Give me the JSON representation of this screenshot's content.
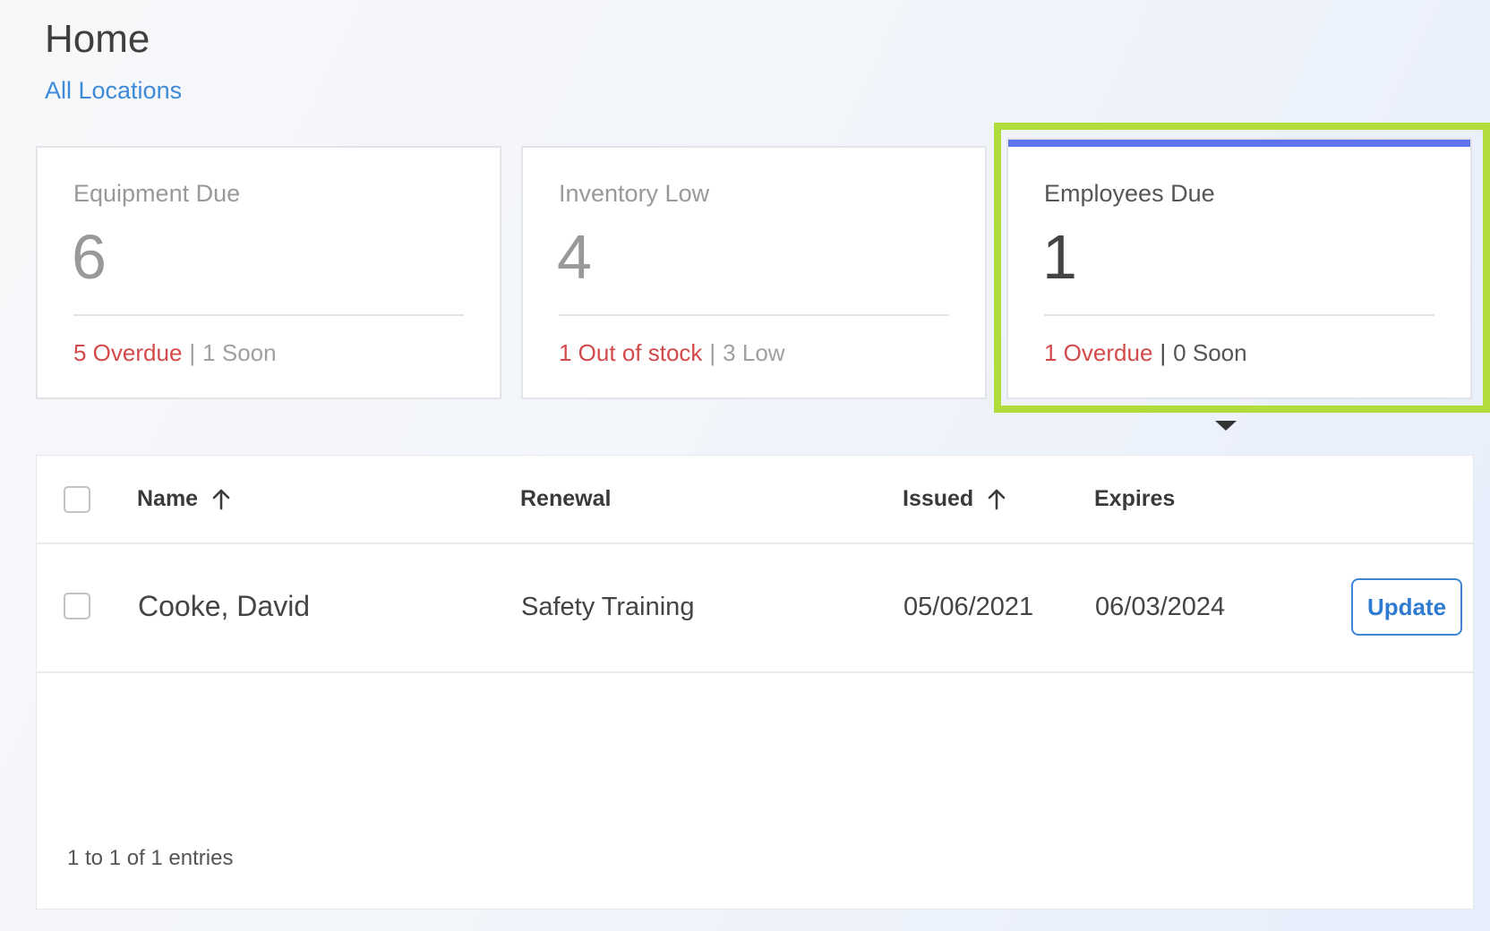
{
  "header": {
    "title": "Home",
    "location_link": "All Locations"
  },
  "cards": [
    {
      "title": "Equipment Due",
      "count": "6",
      "alert_label": "5 Overdue",
      "separator": "|",
      "secondary_label": "1 Soon"
    },
    {
      "title": "Inventory Low",
      "count": "4",
      "alert_label": "1 Out of stock",
      "separator": "|",
      "secondary_label": "3 Low"
    },
    {
      "title": "Employees Due",
      "count": "1",
      "alert_label": "1 Overdue",
      "separator": "|",
      "secondary_label": "0 Soon",
      "selected": true
    }
  ],
  "table": {
    "columns": {
      "name": "Name",
      "renewal": "Renewal",
      "issued": "Issued",
      "expires": "Expires"
    },
    "sorted_columns": [
      "name",
      "issued"
    ],
    "rows": [
      {
        "name": "Cooke, David",
        "renewal": "Safety Training",
        "issued": "05/06/2021",
        "expires": "06/03/2024",
        "action_label": "Update"
      }
    ],
    "entries_text": "1 to 1 of 1 entries"
  },
  "colors": {
    "alert": "#d44a4a",
    "link": "#3d8ad8",
    "accent_bar": "#5f74ea",
    "highlight_frame": "#b1dd3c"
  }
}
